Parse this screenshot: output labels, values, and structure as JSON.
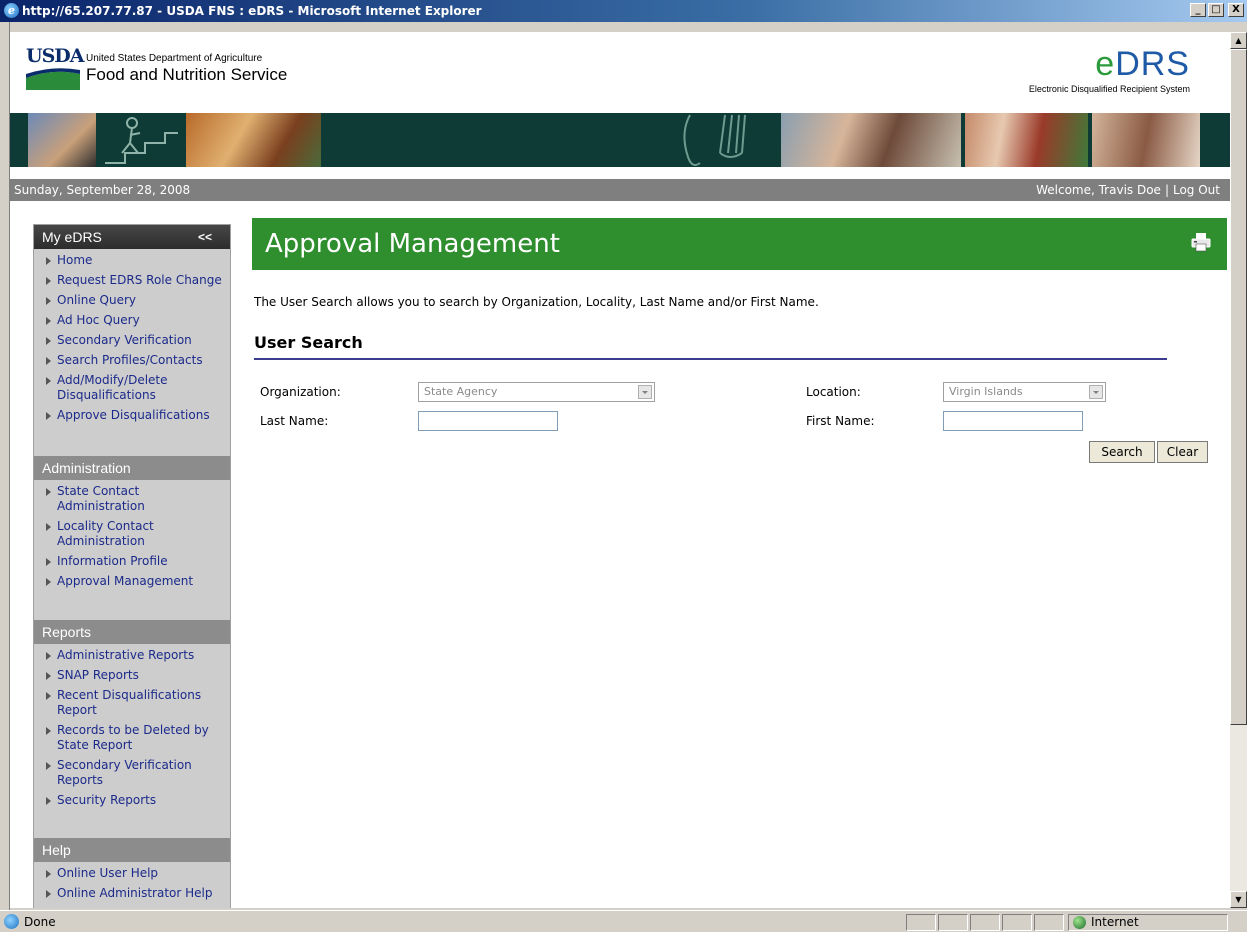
{
  "window": {
    "title": "http://65.207.77.87 - USDA FNS : eDRS - Microsoft Internet Explorer",
    "minimize": "_",
    "maximize": "□",
    "close": "X"
  },
  "statusbar": {
    "status": "Done",
    "zone": "Internet"
  },
  "header": {
    "usda_logo": "USDA",
    "department": "United States Department of Agriculture",
    "agency": "Food and Nutrition Service",
    "app_logo_e": "e",
    "app_logo_rest": "DRS",
    "app_name": "Electronic Disqualified Recipient System"
  },
  "datebar": {
    "date": "Sunday, September 28, 2008",
    "welcome": "Welcome, Travis Doe",
    "separator": "|",
    "logout": "Log Out"
  },
  "sidebar": {
    "sections": [
      {
        "title": "My eDRS",
        "collapse": "<<",
        "items": [
          "Home",
          "Request EDRS Role Change",
          "Online Query",
          "Ad Hoc Query",
          "Secondary Verification",
          "Search Profiles/Contacts",
          "Add/Modify/Delete Disqualifications",
          "Approve Disqualifications"
        ]
      },
      {
        "title": "Administration",
        "items": [
          "State Contact Administration",
          "Locality Contact Administration",
          "Information Profile",
          "Approval Management"
        ]
      },
      {
        "title": "Reports",
        "items": [
          "Administrative Reports",
          "SNAP Reports",
          "Recent Disqualifications Report",
          "Records to be Deleted by State Report",
          "Secondary Verification Reports",
          "Security Reports"
        ]
      },
      {
        "title": "Help",
        "items": [
          "Online User Help",
          "Online Administrator Help"
        ]
      }
    ]
  },
  "main": {
    "title": "Approval Management",
    "intro": "The User Search allows you to search by Organization, Locality, Last Name and/or First Name.",
    "section_title": "User Search",
    "form": {
      "organization_label": "Organization:",
      "organization_value": "State Agency",
      "location_label": "Location:",
      "location_value": "Virgin Islands",
      "last_name_label": "Last Name:",
      "last_name_value": "",
      "first_name_label": "First Name:",
      "first_name_value": "",
      "search_label": "Search",
      "clear_label": "Clear"
    }
  },
  "colors": {
    "title_green": "#2f8e2e",
    "link_blue": "#1b2a8a",
    "band_dark": "#0e3b36"
  }
}
